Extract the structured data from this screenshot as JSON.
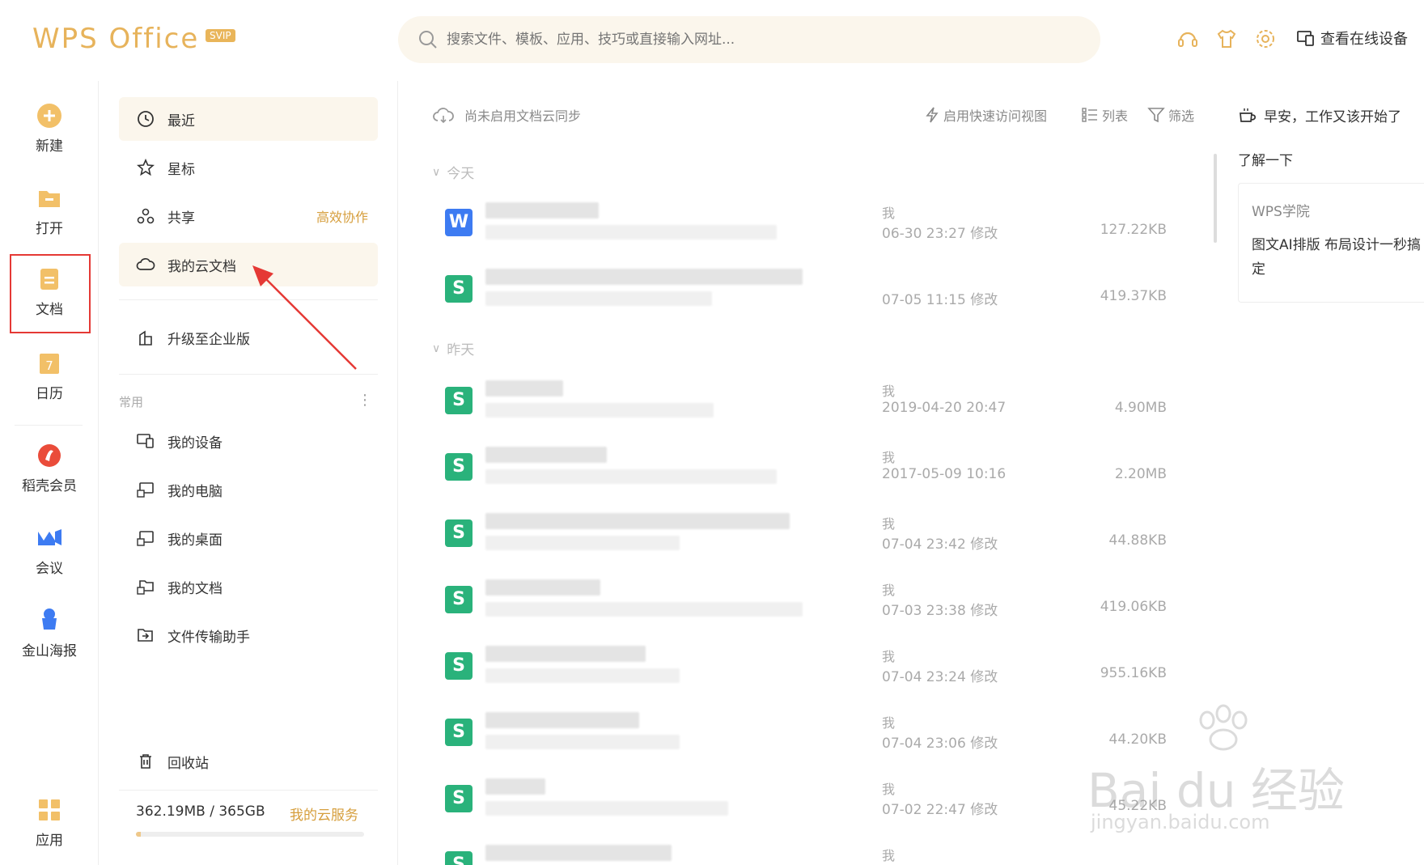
{
  "app": {
    "logo": "WPS Office",
    "badge": "SVIP"
  },
  "header": {
    "search_placeholder": "搜索文件、模板、应用、技巧或直接输入网址...",
    "device_button": "查看在线设备"
  },
  "left_nav": {
    "items": [
      {
        "label": "新建",
        "icon": "plus-circle-icon"
      },
      {
        "label": "打开",
        "icon": "folder-icon"
      },
      {
        "label": "文档",
        "icon": "document-icon"
      },
      {
        "label": "日历",
        "icon": "calendar-icon"
      },
      {
        "label": "稻壳会员",
        "icon": "docer-icon"
      },
      {
        "label": "会议",
        "icon": "meeting-icon"
      },
      {
        "label": "金山海报",
        "icon": "poster-icon"
      },
      {
        "label": "应用",
        "icon": "apps-grid-icon"
      }
    ]
  },
  "panel": {
    "items": {
      "recent": "最近",
      "starred": "星标",
      "shared": "共享",
      "shared_tag": "高效协作",
      "cloud_docs": "我的云文档",
      "upgrade": "升级至企业版"
    },
    "section_common": "常用",
    "common_items": [
      "我的设备",
      "我的电脑",
      "我的桌面",
      "我的文档",
      "文件传输助手"
    ],
    "trash": "回收站",
    "storage_text": "362.19MB / 365GB",
    "storage_used_ratio": 0.001,
    "storage_link": "我的云服务"
  },
  "main": {
    "sync_status": "尚未启用文档云同步",
    "quick_view": "启用快速访问视图",
    "list_view": "列表",
    "filter": "筛选",
    "group_today": "今天",
    "group_yesterday": "昨天",
    "files": [
      {
        "type": "W",
        "owner": "我",
        "time": "06-30 23:27 修改",
        "size": "127.22KB"
      },
      {
        "type": "S",
        "owner": "",
        "time": "07-05 11:15 修改",
        "size": "419.37KB"
      },
      {
        "type": "S",
        "owner": "我",
        "time": "2019-04-20 20:47",
        "size": "4.90MB"
      },
      {
        "type": "S",
        "owner": "我",
        "time": "2017-05-09 10:16",
        "size": "2.20MB"
      },
      {
        "type": "S",
        "owner": "我",
        "time": "07-04 23:42 修改",
        "size": "44.88KB"
      },
      {
        "type": "S",
        "owner": "我",
        "time": "07-03 23:38 修改",
        "size": "419.06KB"
      },
      {
        "type": "S",
        "owner": "我",
        "time": "07-04 23:24 修改",
        "size": "955.16KB"
      },
      {
        "type": "S",
        "owner": "我",
        "time": "07-04 23:06 修改",
        "size": "44.20KB"
      },
      {
        "type": "S",
        "owner": "我",
        "time": "07-02 22:47 修改",
        "size": "45.22KB"
      },
      {
        "type": "S",
        "owner": "我",
        "time": "",
        "size": ""
      }
    ]
  },
  "right": {
    "greeting": "早安，工作又该开始了",
    "learn_more": "了解一下",
    "card_title": "WPS学院",
    "card_text": "图文AI排版 布局设计一秒搞定"
  },
  "watermark": {
    "brand": "Bai du 经验",
    "url": "jingyan.baidu.com"
  },
  "colors": {
    "accent": "#e7b35b",
    "highlight_box": "#e53935",
    "word_icon": "#3d7bf2",
    "sheet_icon": "#2ab27b"
  }
}
